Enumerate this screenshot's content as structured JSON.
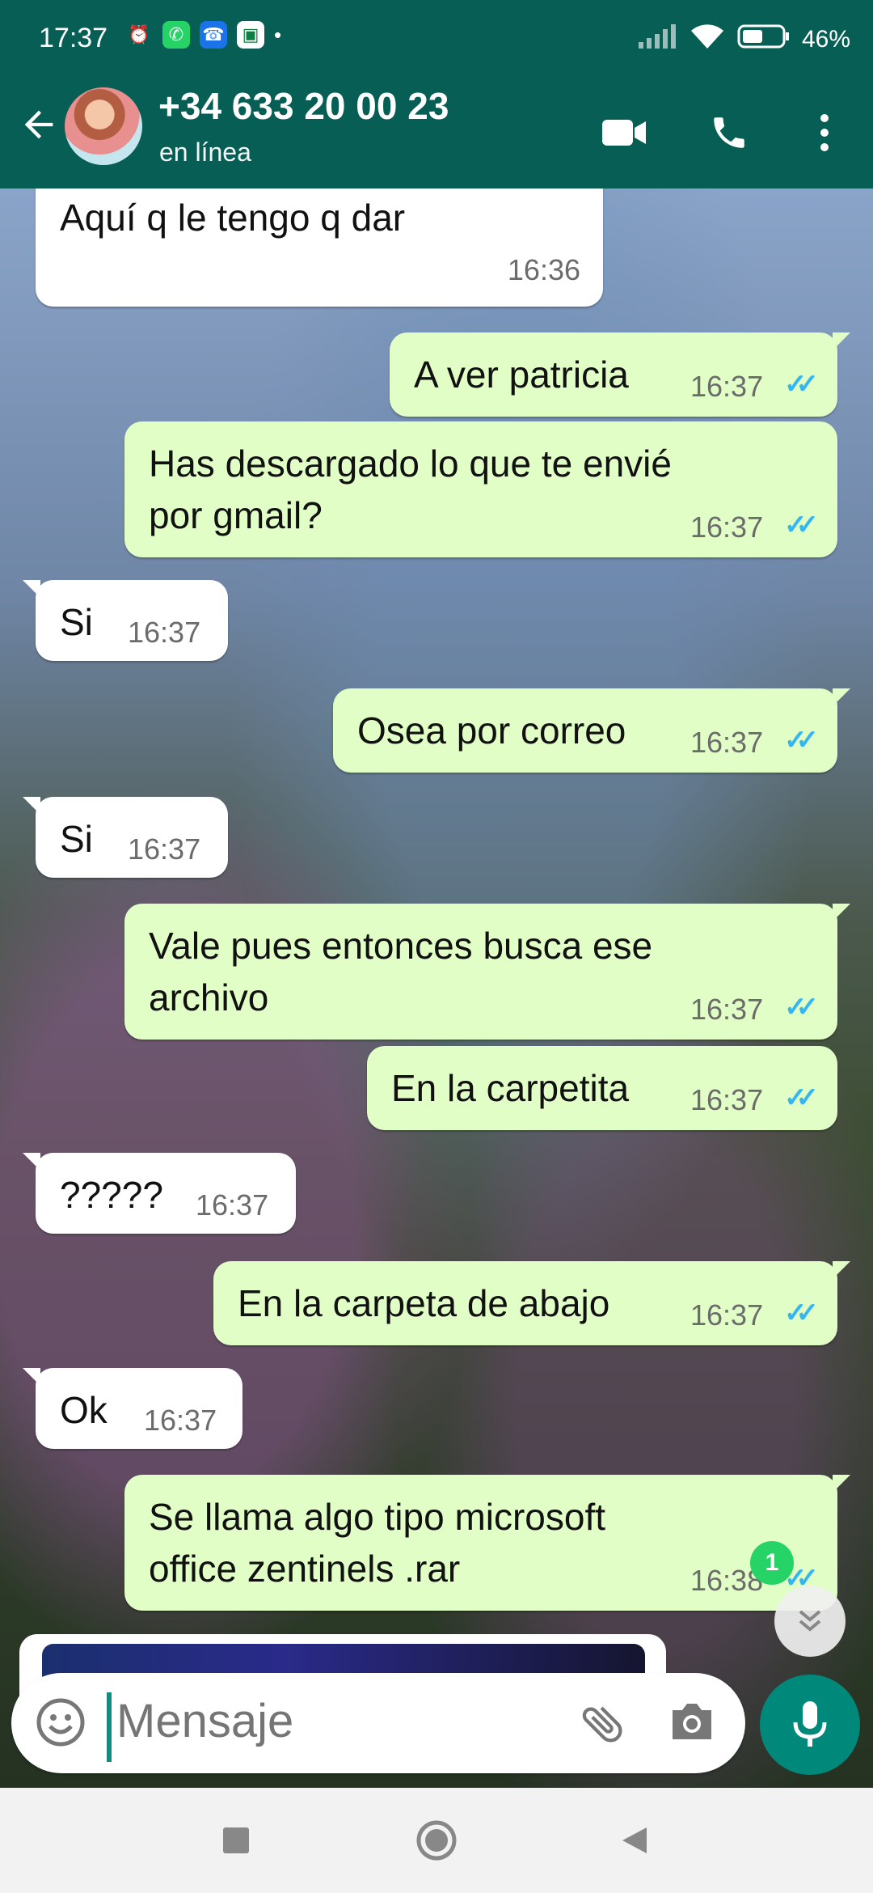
{
  "status_bar": {
    "time": "17:37",
    "battery": "46%"
  },
  "header": {
    "contact_name": "+34 633 20 00 23",
    "contact_status": "en línea"
  },
  "messages": [
    {
      "dir": "in",
      "text": "Aquí q le tengo q dar",
      "time": "16:36"
    },
    {
      "dir": "out",
      "text": "A ver patricia",
      "time": "16:37"
    },
    {
      "dir": "out",
      "text_line1": "Has descargado lo que te envié",
      "text_line2": "por gmail?",
      "time": "16:37"
    },
    {
      "dir": "in",
      "text": "Si",
      "time": "16:37"
    },
    {
      "dir": "out",
      "text": "Osea por correo",
      "time": "16:37"
    },
    {
      "dir": "in",
      "text": "Si",
      "time": "16:37"
    },
    {
      "dir": "out",
      "text_line1": "Vale pues entonces busca ese",
      "text_line2": "archivo",
      "time": "16:37"
    },
    {
      "dir": "out",
      "text": "En la carpetita",
      "time": "16:37"
    },
    {
      "dir": "in",
      "text": "?????",
      "time": "16:37"
    },
    {
      "dir": "out",
      "text": "En la carpeta de abajo",
      "time": "16:37"
    },
    {
      "dir": "in",
      "text": "Ok",
      "time": "16:37"
    },
    {
      "dir": "out",
      "text_line1": "Se llama algo tipo microsoft",
      "text_line2": "office zentinels .rar",
      "time": "16:38"
    }
  ],
  "unread_count": "1",
  "input": {
    "placeholder": "Mensaje"
  },
  "icons": {
    "back": "back-arrow-icon",
    "video": "video-call-icon",
    "call": "phone-icon",
    "menu": "more-vert-icon",
    "emoji": "emoji-icon",
    "attach": "paperclip-icon",
    "camera": "camera-icon",
    "mic": "microphone-icon"
  },
  "colors": {
    "header": "#075e54",
    "outgoing_bubble": "#e1fec6",
    "incoming_bubble": "#ffffff",
    "read_ticks": "#34b7f1",
    "mic_button": "#00897b"
  }
}
